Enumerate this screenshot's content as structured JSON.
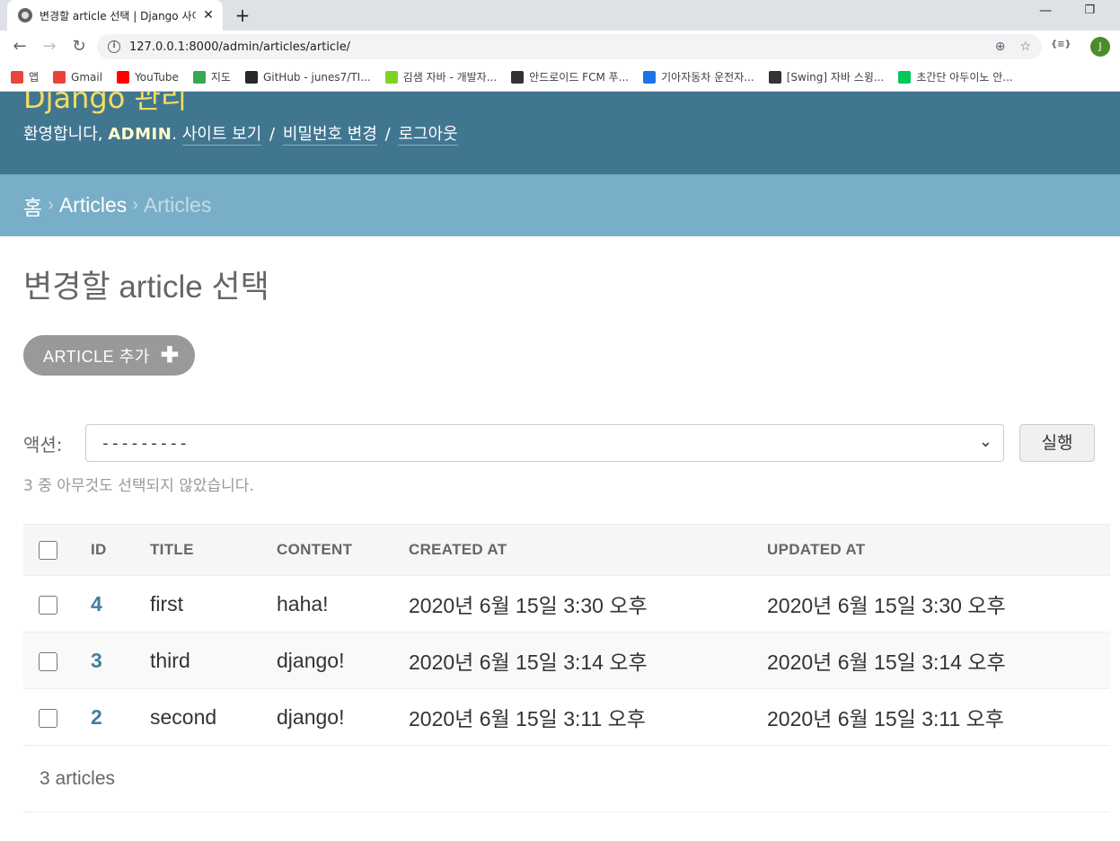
{
  "browser": {
    "tab_title": "변경할 article 선택 | Django 사이트 관리",
    "tab_close": "✕",
    "new_tab": "+",
    "url": "127.0.0.1:8000/admin/articles/article/",
    "window_minimize": "—",
    "window_maximize": "❐",
    "extension": "{≡}",
    "avatar_letter": "J",
    "bookmarks": [
      {
        "label": "앱",
        "icon": "apps-grid-icon",
        "color": "#e8453c"
      },
      {
        "label": "Gmail",
        "icon": "gmail-icon",
        "color": "#ea4335"
      },
      {
        "label": "YouTube",
        "icon": "youtube-icon",
        "color": "#ff0000"
      },
      {
        "label": "지도",
        "icon": "maps-pin-icon",
        "color": "#34a853"
      },
      {
        "label": "GitHub - junes7/TI...",
        "icon": "github-icon",
        "color": "#24292e"
      },
      {
        "label": "김샘 자바 - 개발자...",
        "icon": "blog-icon",
        "color": "#7ed321"
      },
      {
        "label": "안드로이드 FCM 푸...",
        "icon": "tistory-icon",
        "color": "#333333"
      },
      {
        "label": "기아자동차 운전자...",
        "icon": "h-icon",
        "color": "#1a73e8"
      },
      {
        "label": "[Swing] 자바 스윙...",
        "icon": "tistory-icon",
        "color": "#333333"
      },
      {
        "label": "초간단 아두이노 안...",
        "icon": "naver-icon",
        "color": "#03c75a"
      }
    ]
  },
  "header": {
    "brand": "Django 관리",
    "welcome": "환영합니다, ",
    "username": "ADMIN",
    "view_site": "사이트 보기",
    "change_password": "비밀번호 변경",
    "logout": "로그아웃",
    "separator": "/"
  },
  "breadcrumbs": {
    "home": "홈",
    "app": "Articles",
    "current": "Articles",
    "chevron": "›"
  },
  "main": {
    "title": "변경할 article 선택",
    "add_button": "ARTICLE 추가",
    "add_plus": "✚",
    "actions_label": "액션:",
    "actions_selected": "---------",
    "run_button": "실행",
    "selection_note": "3 중 아무것도 선택되지 않았습니다.",
    "columns": [
      "ID",
      "TITLE",
      "CONTENT",
      "CREATED AT",
      "UPDATED AT"
    ],
    "rows": [
      {
        "id": "4",
        "title": "first",
        "content": "haha!",
        "created_at": "2020년 6월 15일 3:30 오후",
        "updated_at": "2020년 6월 15일 3:30 오후"
      },
      {
        "id": "3",
        "title": "third",
        "content": "django!",
        "created_at": "2020년 6월 15일 3:14 오후",
        "updated_at": "2020년 6월 15일 3:14 오후"
      },
      {
        "id": "2",
        "title": "second",
        "content": "django!",
        "created_at": "2020년 6월 15일 3:11 오후",
        "updated_at": "2020년 6월 15일 3:11 오후"
      }
    ],
    "paginator": "3 articles"
  }
}
